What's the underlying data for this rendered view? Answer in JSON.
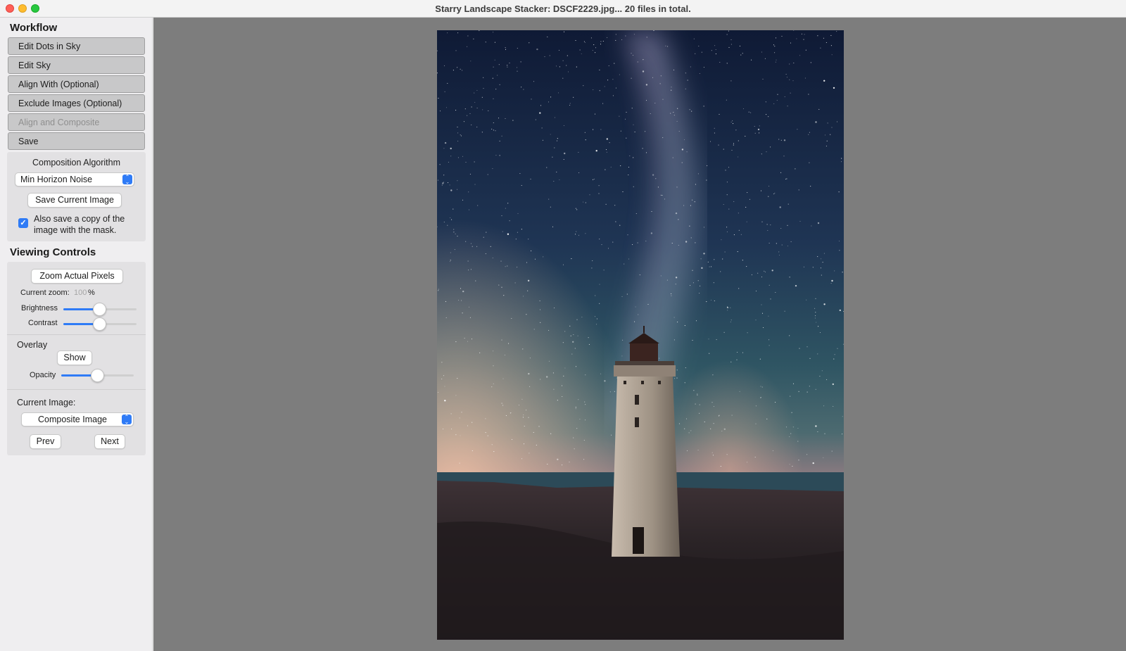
{
  "window": {
    "title": "Starry Landscape Stacker: DSCF2229.jpg...  20 files in total."
  },
  "workflow": {
    "heading": "Workflow",
    "buttons": [
      {
        "label": "Edit Dots in Sky",
        "enabled": true
      },
      {
        "label": "Edit Sky",
        "enabled": true
      },
      {
        "label": "Align With (Optional)",
        "enabled": true
      },
      {
        "label": "Exclude Images (Optional)",
        "enabled": true
      },
      {
        "label": "Align and Composite",
        "enabled": false
      },
      {
        "label": "Save",
        "enabled": true
      }
    ],
    "composition_label": "Composition Algorithm",
    "composition_value": "Min Horizon Noise",
    "save_current_image_label": "Save Current Image",
    "mask_checkbox_checked": true,
    "mask_checkbox_line1": "Also save a copy of the",
    "mask_checkbox_line2": "image with the mask."
  },
  "viewing": {
    "heading": "Viewing Controls",
    "zoom_actual_label": "Zoom Actual Pixels",
    "current_zoom_label": "Current zoom:",
    "current_zoom_value": "100",
    "current_zoom_unit": "%",
    "brightness_label": "Brightness",
    "brightness_level": 0.5,
    "contrast_label": "Contrast",
    "contrast_level": 0.5,
    "overlay_label": "Overlay",
    "overlay_show_label": "Show",
    "opacity_label": "Opacity",
    "opacity_level": 0.5,
    "current_image_label": "Current Image:",
    "current_image_value": "Composite Image",
    "prev_label": "Prev",
    "next_label": "Next"
  },
  "colors": {
    "accent": "#2f7bf6",
    "canvas_bg": "#7d7d7d",
    "sidebar_bg": "#efeef0"
  },
  "icons": {
    "popup_chevron": "chevron-up-down-icon",
    "checkbox": "checkmark-icon"
  }
}
